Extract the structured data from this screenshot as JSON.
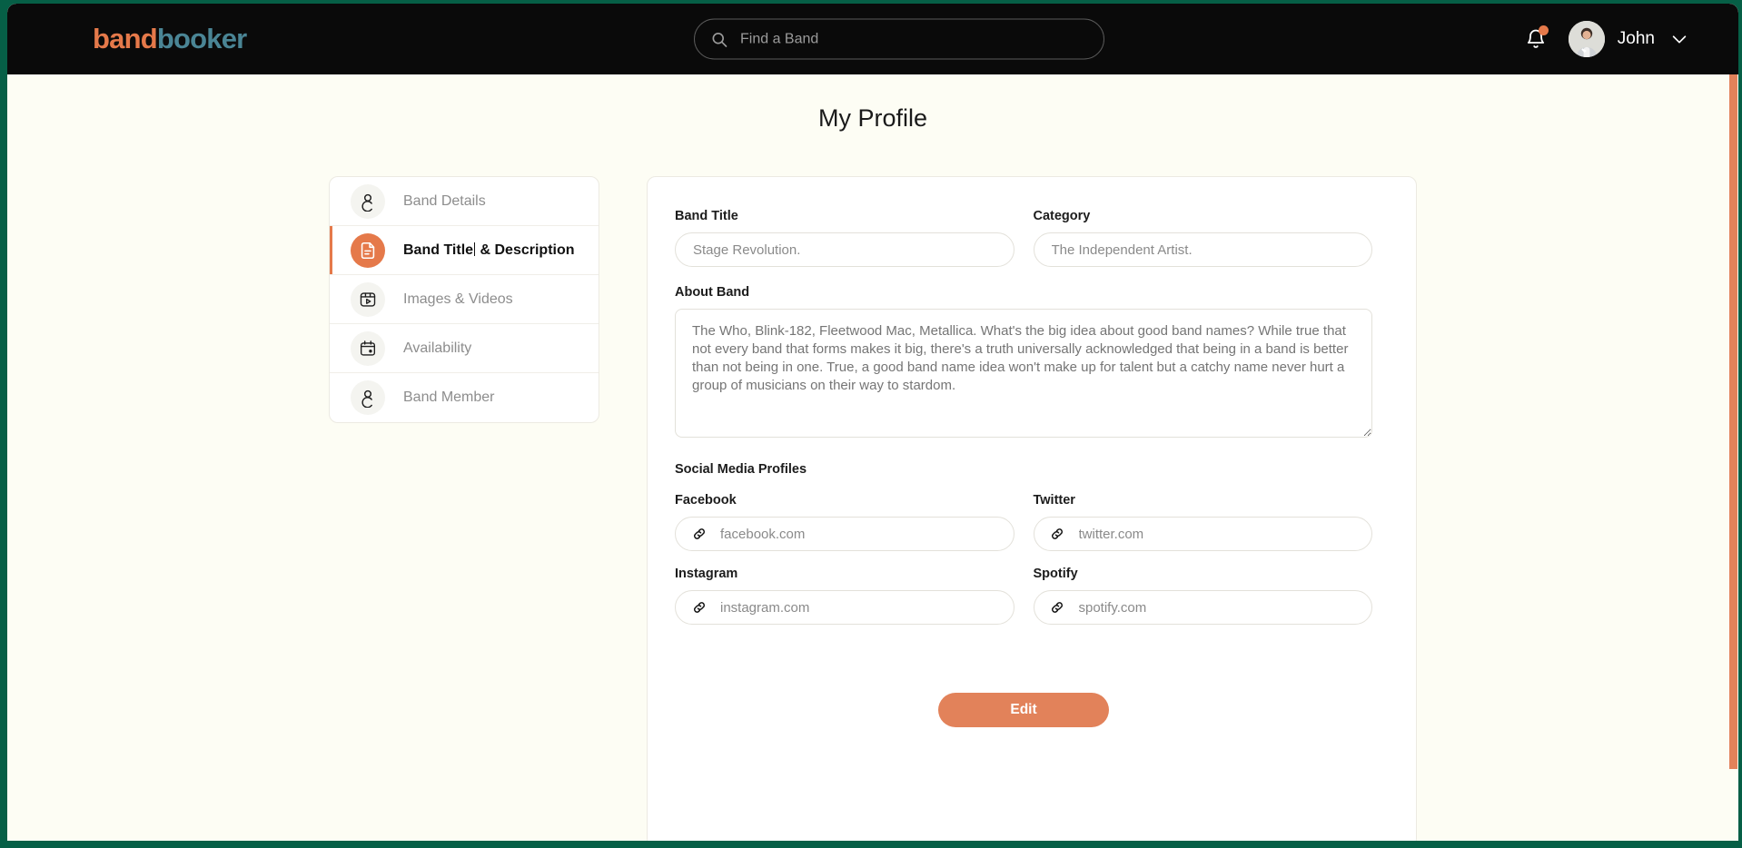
{
  "theme": {
    "frame_green": "#065f46",
    "accent_orange": "#e5794a",
    "brand_teal": "#4a8595",
    "page_background": "#fdfdf4",
    "topbar_background": "#0a0a0a"
  },
  "topbar": {
    "brand_part1": "band",
    "brand_part2": "booker",
    "search": {
      "placeholder": "Find a Band",
      "value": "",
      "icon": "search-icon"
    },
    "notification": {
      "icon": "bell-icon",
      "has_unread": true
    },
    "user": {
      "name": "John",
      "avatar": "user-avatar",
      "chevron": "chevron-down-icon"
    }
  },
  "page": {
    "title": "My Profile"
  },
  "sidebar": {
    "items": [
      {
        "label": "Band Details",
        "icon": "person-icon",
        "active": false
      },
      {
        "label": "Band Title & Description",
        "label_before_caret": "Band Title",
        "label_after_caret": " & Description",
        "icon": "document-icon",
        "active": true
      },
      {
        "label": "Images & Videos",
        "icon": "media-play-icon",
        "active": false
      },
      {
        "label": "Availability",
        "icon": "calendar-icon",
        "active": false
      },
      {
        "label": "Band Member",
        "icon": "person-icon",
        "active": false
      }
    ]
  },
  "form": {
    "band_title": {
      "label": "Band Title",
      "placeholder": "Stage Revolution.",
      "value": ""
    },
    "category": {
      "label": "Category",
      "placeholder": "The Independent Artist.",
      "value": ""
    },
    "about_band": {
      "label": "About Band",
      "placeholder": "The Who, Blink-182, Fleetwood Mac, Metallica. What's the big idea about good band names? While true that not every band that forms makes it big, there's a truth universally acknowledged that being in a band is better than not being in one. True, a good band name idea won't make up for talent but a catchy name never hurt a group of musicians on their way to stardom.",
      "value": ""
    },
    "social_heading": "Social Media Profiles",
    "social": [
      {
        "label": "Facebook",
        "placeholder": "facebook.com",
        "value": "",
        "icon": "link-icon"
      },
      {
        "label": "Twitter",
        "placeholder": "twitter.com",
        "value": "",
        "icon": "link-icon"
      },
      {
        "label": "Instagram",
        "placeholder": "instagram.com",
        "value": "",
        "icon": "link-icon"
      },
      {
        "label": "Spotify",
        "placeholder": "spotify.com",
        "value": "",
        "icon": "link-icon"
      }
    ],
    "edit_button": "Edit"
  },
  "scrollbar": {
    "orientation": "vertical",
    "position": "right"
  }
}
